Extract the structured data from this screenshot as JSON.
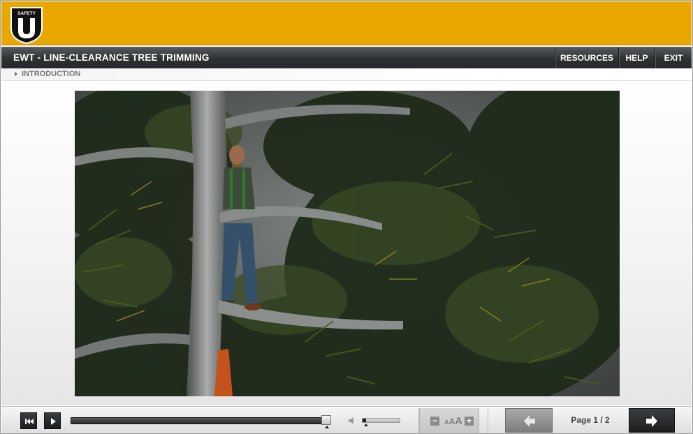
{
  "header": {
    "logo_text": "SAFETY",
    "logo_letter": "U",
    "brand_color": "#e8a800"
  },
  "title_bar": {
    "course_title": "EWT - LINE-CLEARANCE TREE TRIMMING",
    "nav": [
      {
        "label": "RESOURCES"
      },
      {
        "label": "HELP"
      },
      {
        "label": "EXIT"
      }
    ]
  },
  "breadcrumb": {
    "label": "INTRODUCTION"
  },
  "player": {
    "controls": {
      "rewind_icon": "skip-to-start-icon",
      "play_icon": "play-icon",
      "seek_progress": 0.998,
      "volume_icon": "speaker-icon",
      "volume_level": 0.1
    },
    "font_size": {
      "decrease_label": "−",
      "increase_label": "+",
      "label_small": "A",
      "label_mid": "A",
      "label_large": "A"
    },
    "paging": {
      "prev_icon": "arrow-left-icon",
      "next_icon": "arrow-right-icon",
      "page_label": "Page 1 / 2"
    }
  }
}
